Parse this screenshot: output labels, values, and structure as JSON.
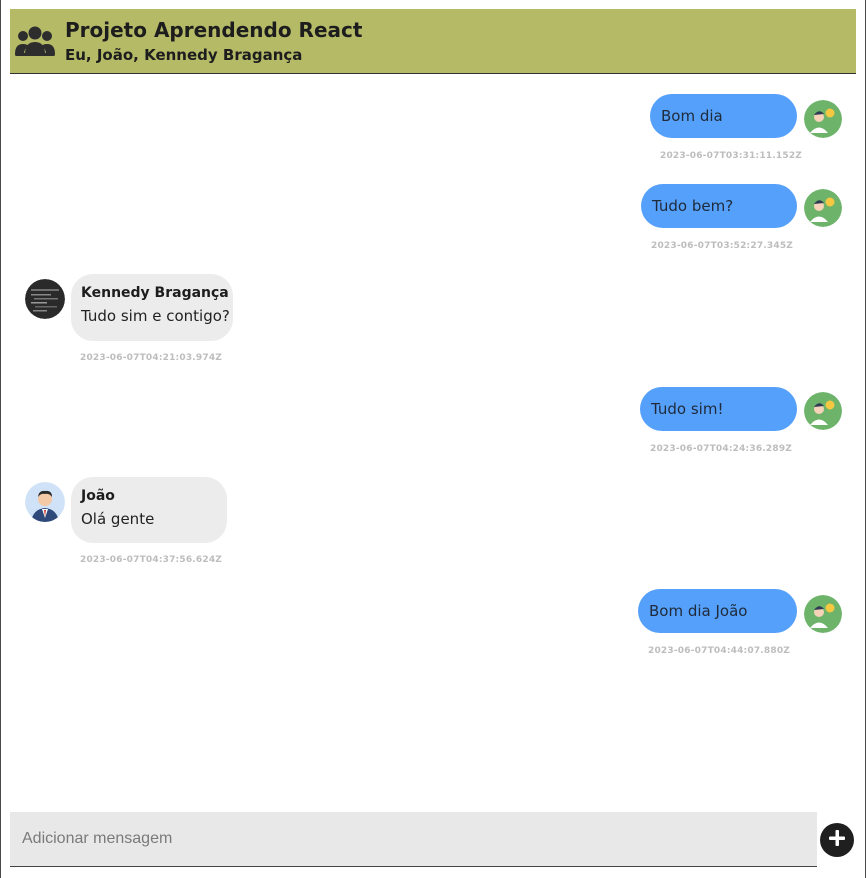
{
  "header": {
    "title": "Projeto Aprendendo React",
    "participants": "Eu, João, Kennedy Bragança",
    "icon": "group-icon"
  },
  "messages": [
    {
      "mine": true,
      "text": "Bom dia",
      "timestamp": "2023-06-07T03:31:11.152Z"
    },
    {
      "mine": true,
      "text": "Tudo bem?",
      "timestamp": "2023-06-07T03:52:27.345Z"
    },
    {
      "mine": false,
      "sender": "Kennedy Bragança",
      "text": "Tudo sim e contigo?",
      "timestamp": "2023-06-07T04:21:03.974Z"
    },
    {
      "mine": true,
      "text": "Tudo sim!",
      "timestamp": "2023-06-07T04:24:36.289Z"
    },
    {
      "mine": false,
      "sender": "João",
      "text": "Olá gente",
      "timestamp": "2023-06-07T04:37:56.624Z"
    },
    {
      "mine": true,
      "text": "Bom dia João",
      "timestamp": "2023-06-07T04:44:07.880Z"
    }
  ],
  "composer": {
    "placeholder": "Adicionar mensagem",
    "value": "",
    "send_icon": "plus-icon"
  },
  "colors": {
    "header_bg": "#b5ba67",
    "my_bubble": "#55a0fa",
    "other_bubble": "#ececec",
    "timestamp": "#bdbdbd"
  }
}
